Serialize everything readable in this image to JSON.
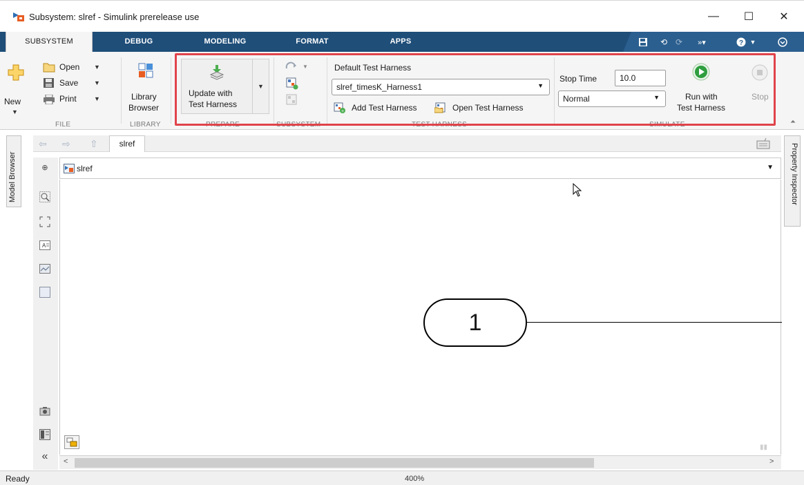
{
  "window": {
    "title": "Subsystem: slref - Simulink prerelease use",
    "minimize_glyph": "—",
    "maximize_glyph": "☐",
    "close_glyph": "✕"
  },
  "tabs": [
    {
      "label": "SUBSYSTEM",
      "active": true
    },
    {
      "label": "DEBUG",
      "active": false
    },
    {
      "label": "MODELING",
      "active": false
    },
    {
      "label": "FORMAT",
      "active": false
    },
    {
      "label": "APPS",
      "active": false
    }
  ],
  "quick_access": {
    "icons": [
      "save-icon",
      "undo-icon",
      "redo-icon",
      "customize-icon",
      "help-icon",
      "collapse-ribbon-icon"
    ]
  },
  "ribbon": {
    "file": {
      "new_label": "New",
      "open_label": "Open",
      "save_label": "Save",
      "print_label": "Print",
      "section_label": "FILE"
    },
    "library": {
      "browser_label_line1": "Library",
      "browser_label_line2": "Browser",
      "section_label": "LIBRARY"
    },
    "prepare": {
      "update_line1": "Update with",
      "update_line2": "Test Harness",
      "section_label": "PREPARE"
    },
    "subsystem": {
      "section_label": "SUBSYSTEM"
    },
    "test_harness": {
      "heading": "Default Test Harness",
      "selected_harness": "slref_timesK_Harness1",
      "add_label": "Add Test Harness",
      "open_label": "Open Test Harness",
      "section_label": "TEST HARNESS"
    },
    "simulate": {
      "stop_time_label": "Stop Time",
      "stop_time_value": "10.0",
      "mode_value": "Normal",
      "run_line1": "Run with",
      "run_line2": "Test Harness",
      "stop_label": "Stop",
      "section_label": "SIMULATE"
    }
  },
  "side_panels": {
    "left": "Model Browser",
    "right": "Property Inspector"
  },
  "explorer": {
    "breadcrumb_tab": "slref",
    "address": "slref"
  },
  "canvas": {
    "inport_label": "1"
  },
  "status": {
    "text": "Ready",
    "zoom": "400%"
  },
  "colors": {
    "tabstrip": "#1f4e79",
    "highlight": "#e0434b",
    "run_green": "#2e9e3e"
  }
}
